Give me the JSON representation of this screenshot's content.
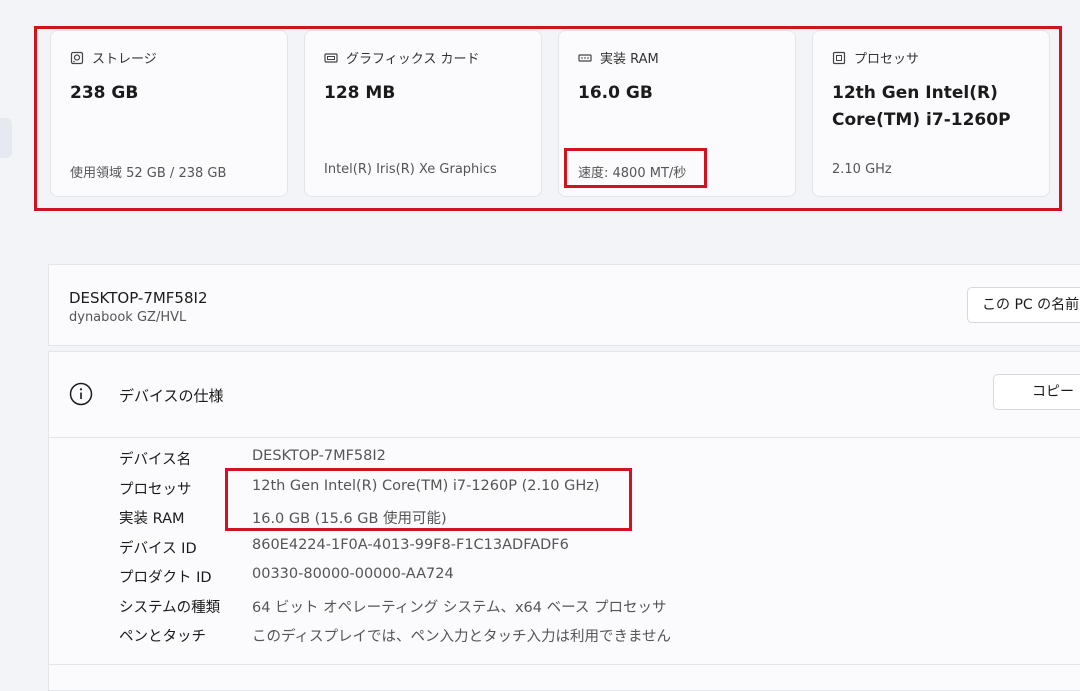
{
  "cards": [
    {
      "icon": "storage-icon",
      "label": "ストレージ",
      "value": "238 GB",
      "sub": "使用領域 52 GB / 238 GB"
    },
    {
      "icon": "graphics-card-icon",
      "label": "グラフィックス カード",
      "value": "128 MB",
      "sub": "Intel(R) Iris(R) Xe Graphics"
    },
    {
      "icon": "ram-icon",
      "label": "実装 RAM",
      "value": "16.0 GB",
      "sub": "速度: 4800 MT/秒"
    },
    {
      "icon": "processor-icon",
      "label": "プロセッサ",
      "value": "12th Gen Intel(R) Core(TM) i7-1260P",
      "sub": "2.10 GHz"
    }
  ],
  "device": {
    "name": "DESKTOP-7MF58I2",
    "model": "dynabook GZ/HVL",
    "rename_button": "この PC の名前を変更"
  },
  "specs": {
    "title": "デバイスの仕様",
    "copy_button": "コピー",
    "rows": [
      {
        "label": "デバイス名",
        "value": "DESKTOP-7MF58I2"
      },
      {
        "label": "プロセッサ",
        "value": "12th Gen Intel(R) Core(TM) i7-1260P (2.10 GHz)"
      },
      {
        "label": "実装 RAM",
        "value": "16.0 GB (15.6 GB 使用可能)"
      },
      {
        "label": "デバイス ID",
        "value": "860E4224-1F0A-4013-99F8-F1C13ADFADF6"
      },
      {
        "label": "プロダクト ID",
        "value": "00330-80000-00000-AA724"
      },
      {
        "label": "システムの種類",
        "value": "64 ビット オペレーティング システム、x64 ベース プロセッサ"
      },
      {
        "label": "ペンとタッチ",
        "value": "このディスプレイでは、ペン入力とタッチ入力は利用できません"
      }
    ]
  },
  "colors": {
    "highlight": "#d0131e",
    "background": "#f2f4f8",
    "card": "#fbfbfd"
  }
}
